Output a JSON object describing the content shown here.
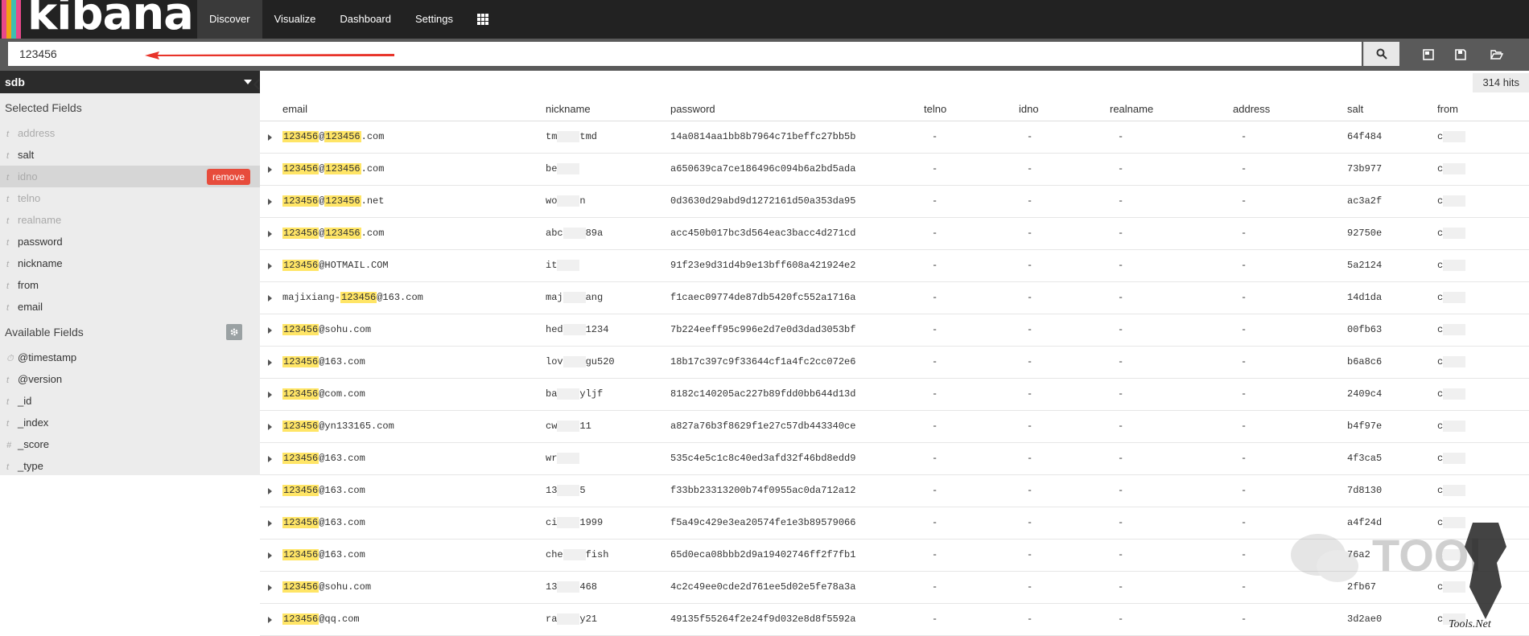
{
  "app": {
    "brand": "kibana"
  },
  "nav": [
    {
      "label": "Discover",
      "active": true
    },
    {
      "label": "Visualize"
    },
    {
      "label": "Dashboard"
    },
    {
      "label": "Settings"
    }
  ],
  "search": {
    "value": "123456"
  },
  "sidebar": {
    "index": "sdb",
    "selected_title": "Selected Fields",
    "selected": [
      {
        "type": "t",
        "name": "address"
      },
      {
        "type": "t",
        "name": "salt"
      },
      {
        "type": "t",
        "name": "idno"
      },
      {
        "type": "t",
        "name": "telno"
      },
      {
        "type": "t",
        "name": "realname"
      },
      {
        "type": "t",
        "name": "password"
      },
      {
        "type": "t",
        "name": "nickname"
      },
      {
        "type": "t",
        "name": "from"
      },
      {
        "type": "t",
        "name": "email"
      }
    ],
    "remove_label": "remove",
    "available_title": "Available Fields",
    "available": [
      {
        "type": "⏱",
        "name": "@timestamp"
      },
      {
        "type": "t",
        "name": "@version"
      },
      {
        "type": "t",
        "name": "_id"
      },
      {
        "type": "t",
        "name": "_index"
      },
      {
        "type": "#",
        "name": "_score"
      },
      {
        "type": "t",
        "name": "_type"
      }
    ]
  },
  "hits": "314 hits",
  "table": {
    "columns": [
      "email",
      "nickname",
      "password",
      "telno",
      "idno",
      "realname",
      "address",
      "salt",
      "from"
    ],
    "empty": "-",
    "rows": [
      {
        "email": [
          "",
          "123456",
          "@",
          "123456",
          ".com"
        ],
        "nickname": "tm",
        "nickname_tail": "tmd",
        "password": "14a0814aa1bb8b7964c71beffc27bb5b",
        "salt": "64f484",
        "from": "c"
      },
      {
        "email": [
          "",
          "123456",
          "@",
          "123456",
          ".com"
        ],
        "nickname": "be",
        "nickname_tail": "",
        "password": "a650639ca7ce186496c094b6a2bd5ada",
        "salt": "73b977",
        "from": "c"
      },
      {
        "email": [
          "",
          "123456",
          "@",
          "123456",
          ".net"
        ],
        "nickname": "wo",
        "nickname_tail": "n",
        "password": "0d3630d29abd9d1272161d50a353da95",
        "salt": "ac3a2f",
        "from": "c"
      },
      {
        "email": [
          "",
          "123456",
          "@",
          "123456",
          ".com"
        ],
        "nickname": "abc",
        "nickname_tail": "89a",
        "password": "acc450b017bc3d564eac3bacc4d271cd",
        "salt": "92750e",
        "from": "c"
      },
      {
        "email": [
          "",
          "123456",
          "@HOTMAIL.COM",
          "",
          ""
        ],
        "nickname": "it",
        "nickname_tail": "",
        "password": "91f23e9d31d4b9e13bff608a421924e2",
        "salt": "5a2124",
        "from": "c"
      },
      {
        "email": [
          "majixiang-",
          "123456",
          "@163.com",
          "",
          ""
        ],
        "nickname": "maj",
        "nickname_tail": "ang",
        "password": "f1caec09774de87db5420fc552a1716a",
        "salt": "14d1da",
        "from": "c"
      },
      {
        "email": [
          "",
          "123456",
          "@sohu.com",
          "",
          ""
        ],
        "nickname": "hed",
        "nickname_tail": "1234",
        "password": "7b224eeff95c996e2d7e0d3dad3053bf",
        "salt": "00fb63",
        "from": "c"
      },
      {
        "email": [
          "",
          "123456",
          "@163.com",
          "",
          ""
        ],
        "nickname": "lov",
        "nickname_tail": "gu520",
        "password": "18b17c397c9f33644cf1a4fc2cc072e6",
        "salt": "b6a8c6",
        "from": "c"
      },
      {
        "email": [
          "",
          "123456",
          "@com.com",
          "",
          ""
        ],
        "nickname": "ba",
        "nickname_tail": "yljf",
        "password": "8182c140205ac227b89fdd0bb644d13d",
        "salt": "2409c4",
        "from": "c"
      },
      {
        "email": [
          "",
          "123456",
          "@yn133165.com",
          "",
          ""
        ],
        "nickname": "cw",
        "nickname_tail": "11",
        "password": "a827a76b3f8629f1e27c57db443340ce",
        "salt": "b4f97e",
        "from": "c"
      },
      {
        "email": [
          "",
          "123456",
          "@163.com",
          "",
          ""
        ],
        "nickname": "wr",
        "nickname_tail": "",
        "password": "535c4e5c1c8c40ed3afd32f46bd8edd9",
        "salt": "4f3ca5",
        "from": "c"
      },
      {
        "email": [
          "",
          "123456",
          "@163.com",
          "",
          ""
        ],
        "nickname": "13",
        "nickname_tail": "5",
        "password": "f33bb23313200b74f0955ac0da712a12",
        "salt": "7d8130",
        "from": "c"
      },
      {
        "email": [
          "",
          "123456",
          "@163.com",
          "",
          ""
        ],
        "nickname": "ci",
        "nickname_tail": "1999",
        "password": "f5a49c429e3ea20574fe1e3b89579066",
        "salt": "a4f24d",
        "from": "c"
      },
      {
        "email": [
          "",
          "123456",
          "@163.com",
          "",
          ""
        ],
        "nickname": "che",
        "nickname_tail": "fish",
        "password": "65d0eca08bbb2d9a19402746ff2f7fb1",
        "salt": "76a2",
        "from": "c"
      },
      {
        "email": [
          "",
          "123456",
          "@sohu.com",
          "",
          ""
        ],
        "nickname": "13",
        "nickname_tail": "468",
        "password": "4c2c49ee0cde2d761ee5d02e5fe78a3a",
        "salt": "2fb67",
        "from": "c"
      },
      {
        "email": [
          "",
          "123456",
          "@qq.com",
          "",
          ""
        ],
        "nickname": "ra",
        "nickname_tail": "y21",
        "password": "49135f55264f2e24f9d032e8d8f5592a",
        "salt": "3d2ae0",
        "from": "c"
      }
    ]
  },
  "watermark": {
    "text": "TOOl",
    "subtext": "Tools.Net"
  },
  "colors": {
    "highlight": "#ffe566",
    "remove": "#e74c3c",
    "arrow": "#e8342a",
    "topbar": "#222222"
  }
}
